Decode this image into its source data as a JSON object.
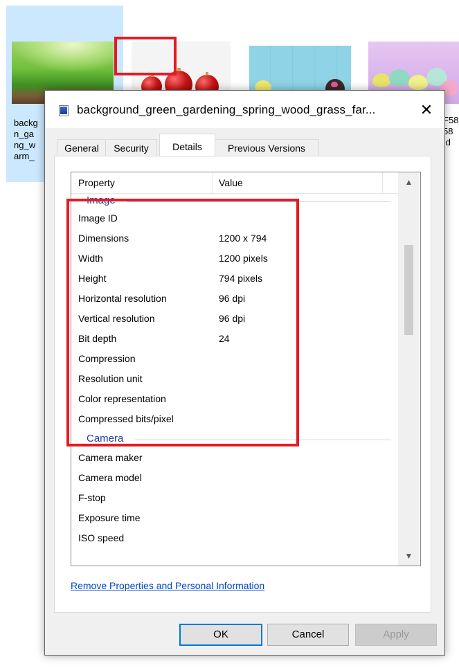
{
  "explorer": {
    "item1_label": "backg\nn_ga\nng_w\narm_",
    "item4_label": "F58\n58\n!d"
  },
  "dialog": {
    "title": "background_green_gardening_spring_wood_grass_far...",
    "close_glyph": "✕",
    "tabs": [
      {
        "label": "General"
      },
      {
        "label": "Security"
      },
      {
        "label": "Details",
        "active": true
      },
      {
        "label": "Previous Versions"
      }
    ],
    "table": {
      "col_property": "Property",
      "col_value": "Value"
    },
    "groups": [
      {
        "name": "Image",
        "rows": [
          {
            "k": "Image ID",
            "v": ""
          },
          {
            "k": "Dimensions",
            "v": "1200 x 794"
          },
          {
            "k": "Width",
            "v": "1200 pixels"
          },
          {
            "k": "Height",
            "v": "794 pixels"
          },
          {
            "k": "Horizontal resolution",
            "v": "96 dpi"
          },
          {
            "k": "Vertical resolution",
            "v": "96 dpi"
          },
          {
            "k": "Bit depth",
            "v": "24"
          },
          {
            "k": "Compression",
            "v": ""
          },
          {
            "k": "Resolution unit",
            "v": ""
          },
          {
            "k": "Color representation",
            "v": ""
          },
          {
            "k": "Compressed bits/pixel",
            "v": ""
          }
        ]
      },
      {
        "name": "Camera",
        "rows": [
          {
            "k": "Camera maker",
            "v": ""
          },
          {
            "k": "Camera model",
            "v": ""
          },
          {
            "k": "F-stop",
            "v": ""
          },
          {
            "k": "Exposure time",
            "v": ""
          },
          {
            "k": "ISO speed",
            "v": ""
          }
        ]
      }
    ],
    "remove_link": "Remove Properties and Personal Information",
    "buttons": {
      "ok": "OK",
      "cancel": "Cancel",
      "apply": "Apply"
    },
    "icons": {
      "scroll_up": "chevron-up-icon",
      "scroll_down": "chevron-down-icon",
      "file": "image-file-icon"
    },
    "colors": {
      "highlight": "#e31b23",
      "group_label": "#1e3fa8",
      "link": "#0046c8",
      "focus": "#0078d7"
    }
  }
}
